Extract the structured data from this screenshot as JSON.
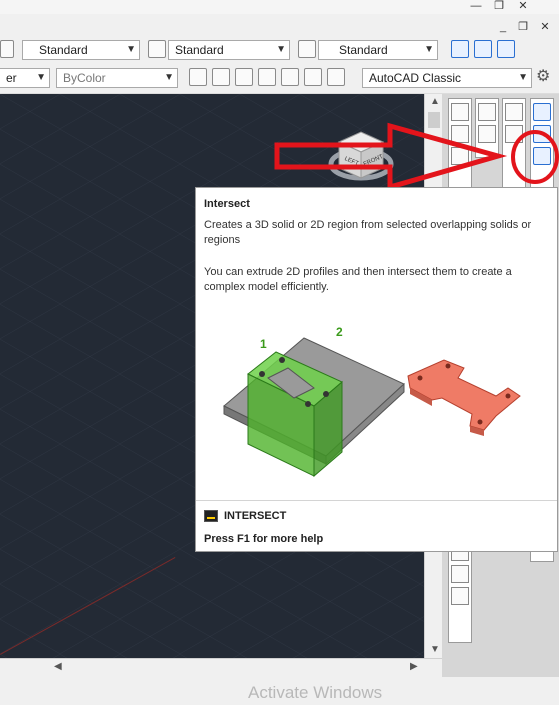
{
  "window": {
    "minimize": "—",
    "restore": "❐",
    "close": "✕"
  },
  "toolbar1": {
    "text_style": "Standard",
    "dim_style": "Standard",
    "table_style": "Standard"
  },
  "toolbar2": {
    "layer_fragment": "er",
    "color": "ByColor",
    "workspace": "AutoCAD Classic"
  },
  "viewcube": {
    "left": "LEFT",
    "front": "FRONT"
  },
  "tooltip": {
    "title": "Intersect",
    "description": "Creates a 3D solid or 2D region from selected overlapping solids or regions",
    "detail": "You can extrude 2D profiles and then intersect them to create a complex model efficiently.",
    "label_1": "1",
    "label_2": "2",
    "command": "INTERSECT",
    "help": "Press F1 for more help"
  },
  "watermark": "Activate Windows",
  "colors": {
    "canvas": "#232a35",
    "annotation": "#e3141b",
    "solid_green": "#6fd14a",
    "result_red": "#ef7b66"
  }
}
